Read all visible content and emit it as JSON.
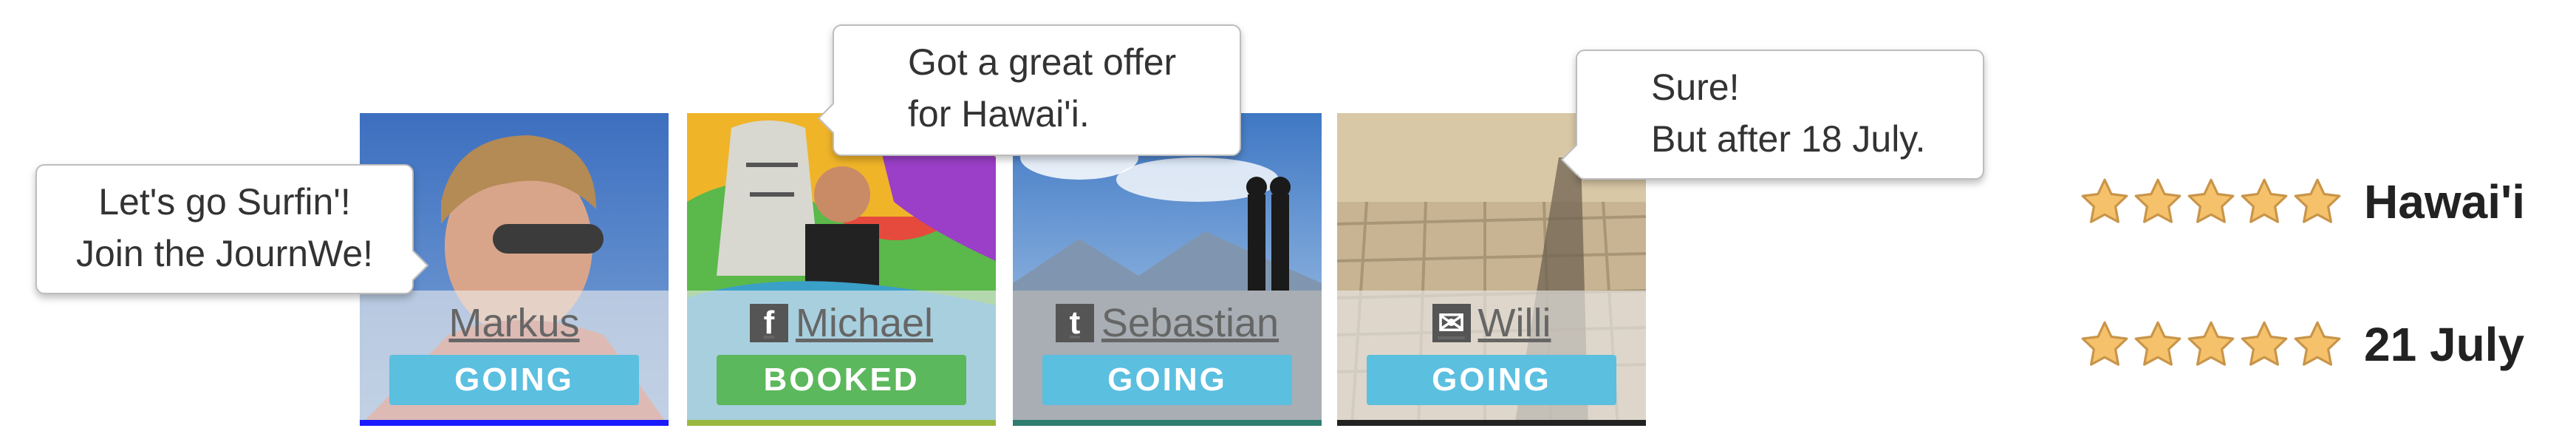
{
  "colors": {
    "going": "#5bbfe0",
    "booked": "#5cb85c",
    "star_fill": "#f5c26b",
    "star_stroke": "#c9954a"
  },
  "participants": [
    {
      "name": "Markus",
      "network_icon": "",
      "status": "GOING",
      "strip_color": "#1a1aff"
    },
    {
      "name": "Michael",
      "network_icon": "facebook-icon",
      "network_glyph": "f",
      "status": "BOOKED",
      "strip_color": "#9ab840"
    },
    {
      "name": "Sebastian",
      "network_icon": "twitter-icon",
      "network_glyph": "t",
      "status": "GOING",
      "strip_color": "#2e7d6e"
    },
    {
      "name": "Willi",
      "network_icon": "email-icon",
      "network_glyph": "✉",
      "status": "GOING",
      "strip_color": "#222222"
    }
  ],
  "bubbles": [
    {
      "line1": "Let's go Surfin'!",
      "line2": "Join the JournWe!"
    },
    {
      "line1": "Got a great offer",
      "line2": "for Hawai'i."
    },
    {
      "line1": "Sure!",
      "line2": "But after 18 July."
    }
  ],
  "ratings": [
    {
      "label": "Hawai'i",
      "icon": "star-icon",
      "stars": 5
    },
    {
      "label": "21 July",
      "icon": "star-icon",
      "stars": 5
    }
  ]
}
